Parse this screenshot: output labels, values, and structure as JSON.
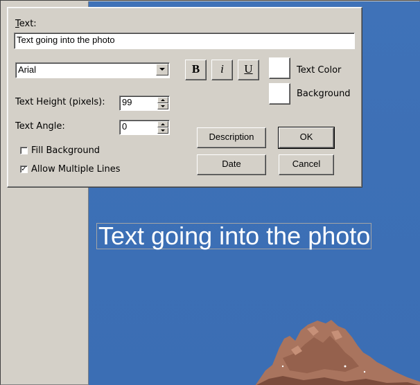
{
  "dialog": {
    "text_label": "Text:",
    "text_value": "Text going into the photo",
    "font": {
      "selected": "Arial"
    },
    "style_buttons": {
      "bold": "B",
      "italic": "i",
      "underline": "U"
    },
    "text_color_label": "Text Color",
    "background_label": "Background",
    "height": {
      "label": "Text Height (pixels):",
      "value": "99"
    },
    "angle": {
      "label": "Text Angle:",
      "value": "0"
    },
    "fill_background": {
      "label": "Fill Background",
      "checked": false
    },
    "allow_multiple_lines": {
      "label": "Allow Multiple Lines",
      "checked": true
    },
    "buttons": {
      "description": "Description",
      "ok": "OK",
      "date": "Date",
      "cancel": "Cancel"
    }
  },
  "photo": {
    "overlay_text": "Text going into the photo"
  },
  "colors": {
    "dialog_bg": "#d4d0c8",
    "sky": "#3d70b6",
    "overlay_text": "#ffffff",
    "text_color_swatch": "#ffffff",
    "background_swatch": "#ffffff"
  },
  "icons": {
    "dropdown": "chevron-down-icon",
    "spin_up": "spin-up-icon",
    "spin_down": "spin-down-icon",
    "check": "check-icon"
  }
}
